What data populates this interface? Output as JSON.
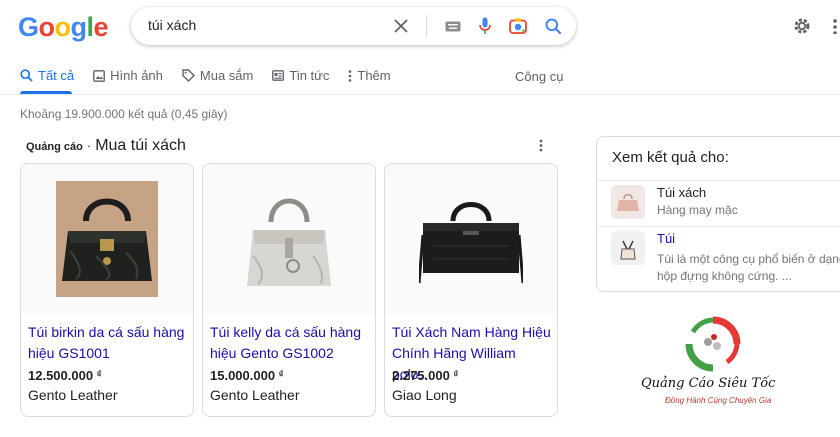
{
  "logo": {
    "letters": [
      "G",
      "o",
      "o",
      "g",
      "l",
      "e"
    ]
  },
  "search": {
    "query": "túi xách"
  },
  "tabs": [
    {
      "label": "Tất cả",
      "icon": "search-icon",
      "active": true
    },
    {
      "label": "Hình ảnh",
      "icon": "image-icon"
    },
    {
      "label": "Mua sắm",
      "icon": "tag-icon"
    },
    {
      "label": "Tin tức",
      "icon": "news-icon"
    },
    {
      "label": "Thêm",
      "icon": "more-vert-icon"
    }
  ],
  "tools_label": "Công cụ",
  "result_stats": "Khoảng 19.900.000 kết quả (0,45 giây)",
  "ads": {
    "label": "Quảng cáo",
    "separator": "·",
    "title": "Mua túi xách",
    "products": [
      {
        "title": "Túi birkin da cá sấu hàng hiệu GS1001",
        "price": "12.500.000",
        "currency": "₫",
        "store": "Gento Leather"
      },
      {
        "title": "Túi kelly da cá sấu hàng hiệu Gento GS1002",
        "price": "15.000.000",
        "currency": "₫",
        "store": "Gento Leather"
      },
      {
        "title": "Túi Xách Nam Hàng Hiệu Chính Hãng William polo…",
        "price": "2.275.000",
        "currency": "₫",
        "store": "Giao Long"
      }
    ]
  },
  "side_panel": {
    "title": "Xem kết quả cho:",
    "items": [
      {
        "name": "Túi xách",
        "subtitle": "Hàng may mặc"
      },
      {
        "name": "Túi",
        "desc_line1": "Túi là một công cụ phổ biến ở dạng",
        "desc_line2": "hộp đựng không cứng. ..."
      }
    ]
  },
  "watermark": {
    "line1": "Quảng Cáo Siêu Tốc",
    "line2": "Đồng Hành Cùng Chuyên Gia"
  },
  "colors": {
    "link": "#1a0dab",
    "accent": "#1a73e8",
    "muted": "#70757a"
  }
}
